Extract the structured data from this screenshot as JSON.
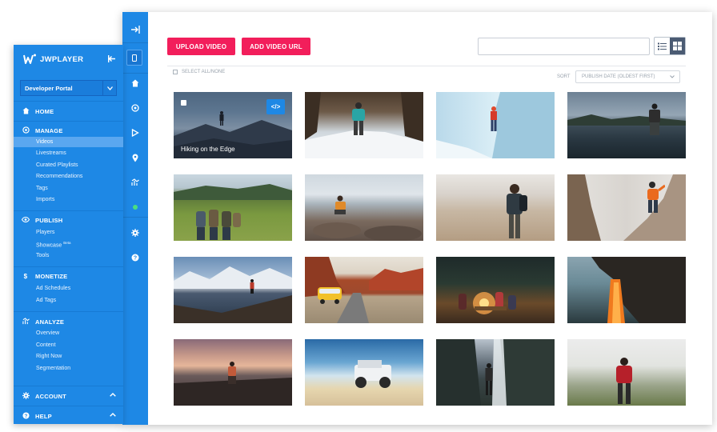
{
  "brand": {
    "name": "JWPLAYER"
  },
  "property_selector": {
    "value": "Developer Portal"
  },
  "sidebar": {
    "sections": [
      {
        "label": "HOME",
        "icon": "home-icon"
      },
      {
        "label": "MANAGE",
        "icon": "manage-icon",
        "items": [
          "Videos",
          "Livestreams",
          "Curated Playlists",
          "Recommendations",
          "Tags",
          "Imports"
        ],
        "active": "Videos"
      },
      {
        "label": "PUBLISH",
        "icon": "eye-icon",
        "items": [
          "Players",
          "Showcase",
          "Tools"
        ],
        "badges": {
          "Showcase": "Beta"
        }
      },
      {
        "label": "MONETIZE",
        "icon": "dollar-icon",
        "items": [
          "Ad Schedules",
          "Ad Tags"
        ]
      },
      {
        "label": "ANALYZE",
        "icon": "chart-icon",
        "items": [
          "Overview",
          "Content",
          "Right Now",
          "Segmentation"
        ]
      },
      {
        "label": "ACCOUNT",
        "icon": "gear-icon"
      },
      {
        "label": "HELP",
        "icon": "help-icon"
      }
    ]
  },
  "toolbar": {
    "upload_label": "UPLOAD VIDEO",
    "add_url_label": "ADD VIDEO URL",
    "search_value": "",
    "select_all_label": "SELECT ALL/NONE",
    "sort_label": "SORT",
    "sort_value": "PUBLISH DATE (OLDEST FIRST)"
  },
  "videos": [
    {
      "title": "Hiking on the Edge",
      "hovered": true,
      "embed_label": "</>"
    },
    {
      "title": ""
    },
    {
      "title": ""
    },
    {
      "title": ""
    },
    {
      "title": ""
    },
    {
      "title": ""
    },
    {
      "title": ""
    },
    {
      "title": ""
    },
    {
      "title": ""
    },
    {
      "title": ""
    },
    {
      "title": ""
    },
    {
      "title": ""
    },
    {
      "title": ""
    },
    {
      "title": ""
    },
    {
      "title": ""
    },
    {
      "title": ""
    }
  ],
  "colors": {
    "accent": "#f21e5b",
    "sidebar": "#1e88e5",
    "sidebar_active": "#5aa7f0",
    "status_dot": "#4ade80"
  }
}
